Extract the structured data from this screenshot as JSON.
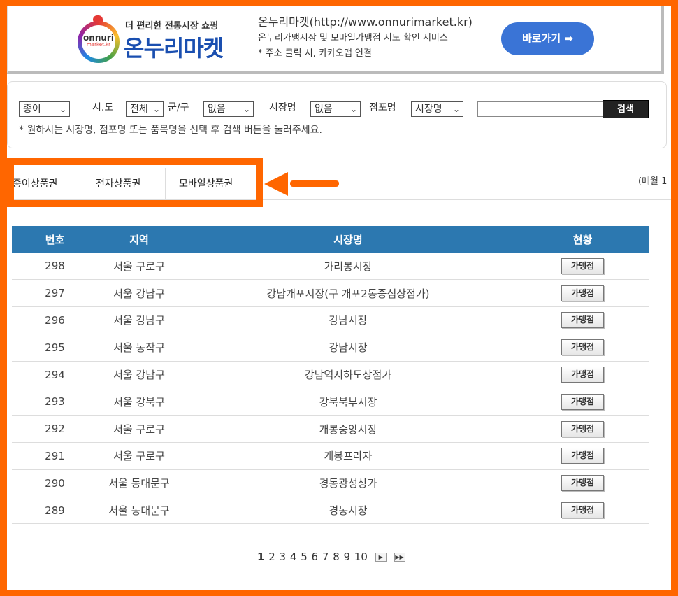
{
  "banner": {
    "tagline": "더 편리한 전통시장 쇼핑",
    "brand_name": "온누리마켓",
    "logo_text_main": "onnuri",
    "logo_text_sub": "market.kr",
    "title": "온누리마켓(http://www.onnurimarket.kr)",
    "desc": "온누리가맹시장 및 모바일가맹점 지도 확인 서비스",
    "note": "* 주소 클릭 시, 카카오맵 연결",
    "go_button": "바로가기 ➡"
  },
  "search": {
    "type_value": "종이",
    "sido_label": "시.도",
    "sido_value": "전체",
    "gungu_label": "군/구",
    "gungu_value": "없음",
    "market_label": "시장명",
    "market_value": "없음",
    "store_label": "점포명",
    "store_value": "시장명",
    "input_value": "",
    "search_button": "검색",
    "hint": "* 원하시는 시장명, 점포명 또는 품목명을 선택 후 검색 버튼을 눌러주세요."
  },
  "tabs": [
    {
      "label": "종이상품권"
    },
    {
      "label": "전자상품권"
    },
    {
      "label": "모바일상품권"
    }
  ],
  "monthly_note": "(매월 1",
  "table": {
    "headers": [
      "번호",
      "지역",
      "시장명",
      "현황"
    ],
    "rows": [
      {
        "no": "298",
        "region": "서울 구로구",
        "market": "가리봉시장",
        "status": "가맹점"
      },
      {
        "no": "297",
        "region": "서울 강남구",
        "market": "강남개포시장(구 개포2동중심상점가)",
        "status": "가맹점"
      },
      {
        "no": "296",
        "region": "서울 강남구",
        "market": "강남시장",
        "status": "가맹점"
      },
      {
        "no": "295",
        "region": "서울 동작구",
        "market": "강남시장",
        "status": "가맹점"
      },
      {
        "no": "294",
        "region": "서울 강남구",
        "market": "강남역지하도상점가",
        "status": "가맹점"
      },
      {
        "no": "293",
        "region": "서울 강북구",
        "market": "강북북부시장",
        "status": "가맹점"
      },
      {
        "no": "292",
        "region": "서울 구로구",
        "market": "개봉중앙시장",
        "status": "가맹점"
      },
      {
        "no": "291",
        "region": "서울 구로구",
        "market": "개봉프라자",
        "status": "가맹점"
      },
      {
        "no": "290",
        "region": "서울 동대문구",
        "market": "경동광성상가",
        "status": "가맹점"
      },
      {
        "no": "289",
        "region": "서울 동대문구",
        "market": "경동시장",
        "status": "가맹점"
      }
    ]
  },
  "pagination": {
    "pages": [
      "1",
      "2",
      "3",
      "4",
      "5",
      "6",
      "7",
      "8",
      "9",
      "10"
    ],
    "current": "1",
    "next": "▶",
    "last": "▶▶"
  },
  "colors": {
    "annotation": "#ff6600",
    "table_header": "#2c78b0",
    "go_button": "#3a74d6"
  }
}
